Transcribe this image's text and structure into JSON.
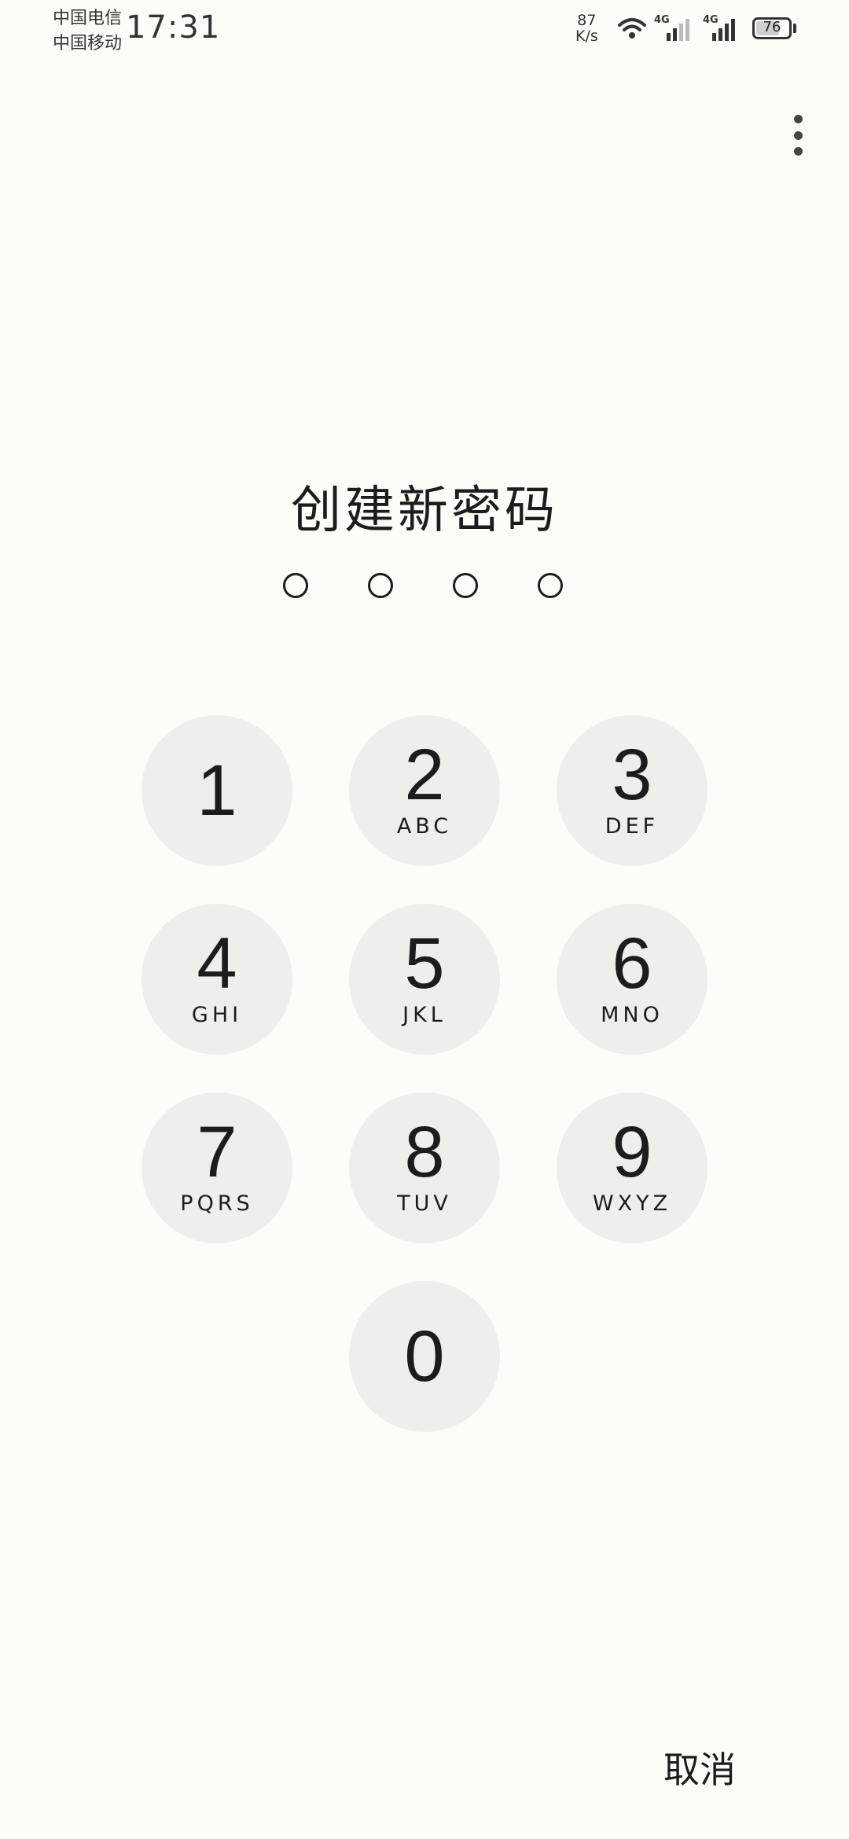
{
  "status_bar": {
    "carrier_1": "中国电信",
    "carrier_2": "中国移动",
    "time": "17:31",
    "net_speed_value": "87",
    "net_speed_unit": "K/s",
    "network_1": "4G",
    "network_2": "4G",
    "battery": "76",
    "battery_level": 0.76
  },
  "title": "创建新密码",
  "pin": {
    "length": 4,
    "entered": 0
  },
  "keypad": {
    "keys": [
      {
        "digit": "1",
        "letters": ""
      },
      {
        "digit": "2",
        "letters": "ABC"
      },
      {
        "digit": "3",
        "letters": "DEF"
      },
      {
        "digit": "4",
        "letters": "GHI"
      },
      {
        "digit": "5",
        "letters": "JKL"
      },
      {
        "digit": "6",
        "letters": "MNO"
      },
      {
        "digit": "7",
        "letters": "PQRS"
      },
      {
        "digit": "8",
        "letters": "TUV"
      },
      {
        "digit": "9",
        "letters": "WXYZ"
      },
      {
        "digit": "0",
        "letters": ""
      }
    ]
  },
  "cancel_label": "取消",
  "icons": {
    "menu": "more-vertical-icon",
    "wifi": "wifi-icon",
    "signal": "signal-icon",
    "battery": "battery-icon"
  }
}
